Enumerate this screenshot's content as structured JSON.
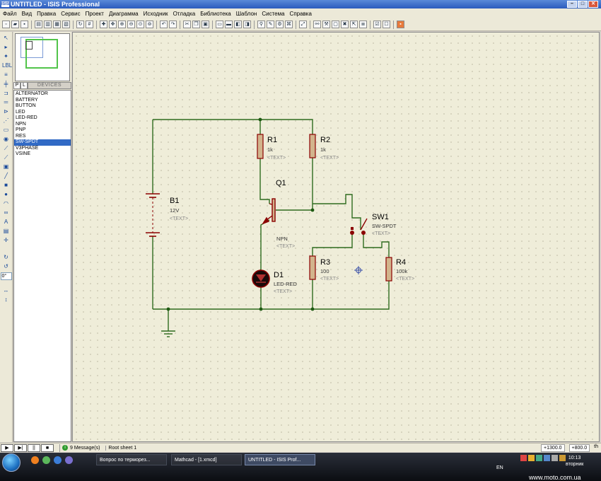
{
  "window": {
    "title": "UNTITLED - ISIS Professional",
    "app_badge": "ISIS"
  },
  "menu": [
    "Файл",
    "Вид",
    "Правка",
    "Сервис",
    "Проект",
    "Диаграмма",
    "Исходник",
    "Отладка",
    "Библиотека",
    "Шаблон",
    "Система",
    "Справка"
  ],
  "panel": {
    "tab_p": "P",
    "tab_l": "L",
    "tab_devices": "DEVICES",
    "devices": [
      "ALTERNATOR",
      "BATTERY",
      "BUTTON",
      "LED",
      "LED-RED",
      "NPN",
      "PNP",
      "RES",
      "SW-SPDT",
      "V3PHASE",
      "VSINE"
    ],
    "selected_device": "SW-SPDT",
    "angle": "0°"
  },
  "schematic": {
    "components": {
      "b1": {
        "ref": "B1",
        "value": "12V",
        "text": "<TEXT>"
      },
      "r1": {
        "ref": "R1",
        "value": "1k",
        "text": "<TEXT>"
      },
      "r2": {
        "ref": "R2",
        "value": "1k",
        "text": "<TEXT>"
      },
      "q1": {
        "ref": "Q1",
        "value": "NPN",
        "text": "<TEXT>"
      },
      "sw1": {
        "ref": "SW1",
        "value": "SW-SPDT",
        "text": "<TEXT>"
      },
      "r3": {
        "ref": "R3",
        "value": "100",
        "text": "<TEXT>"
      },
      "r4": {
        "ref": "R4",
        "value": "100k",
        "text": "<TEXT>"
      },
      "d1": {
        "ref": "D1",
        "value": "LED-RED",
        "text": "<TEXT>"
      }
    },
    "colors": {
      "wire": "#2e6b1e",
      "component": "#8b0000",
      "resistor_fill": "#d2b48c",
      "junction": "#1e5a12",
      "led_fill": "#1a0a0a"
    }
  },
  "status": {
    "messages": "9 Message(s)",
    "sheet": "Root sheet 1",
    "x_coord": "+1300.0",
    "y_coord": "+800.0",
    "unit": "th"
  },
  "taskbar": {
    "tasks": [
      "Вопрос по терморез...",
      "Mathcad - [1.xmcd]",
      "UNTITLED - ISIS Prof..."
    ],
    "lang": "EN",
    "time": "10:13",
    "day": "вторник",
    "watermark": "www.moto.com.ua"
  }
}
